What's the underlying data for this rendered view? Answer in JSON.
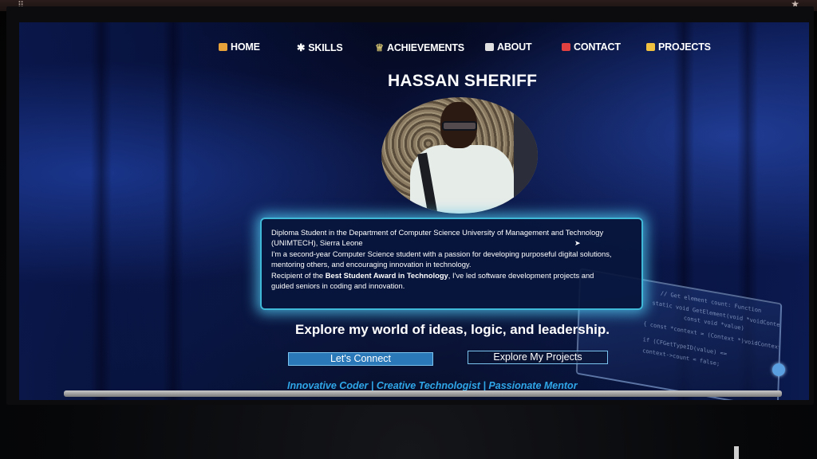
{
  "nav": {
    "items": [
      {
        "label": "HOME",
        "icon": "home-icon",
        "color": "#e8a23a"
      },
      {
        "label": "SKILLS",
        "icon": "gear-icon",
        "color": "#e0e0e0"
      },
      {
        "label": "ACHIEVEMENTS",
        "icon": "trophy-icon",
        "color": "#d0c070"
      },
      {
        "label": "ABOUT",
        "icon": "id-card-icon",
        "color": "#e0e0e0"
      },
      {
        "label": "CONTACT",
        "icon": "mailbox-icon",
        "color": "#e04040"
      },
      {
        "label": "PROJECTS",
        "icon": "folder-icon",
        "color": "#f0c040"
      }
    ]
  },
  "hero": {
    "name": "HASSAN SHERIFF"
  },
  "bio": {
    "line1": "Diploma Student in the Department of Computer Science University of Management and Technology",
    "line2": "(UNIMTECH), Sierra Leone",
    "line3": "I'm a second-year Computer Science student with a passion for developing purposeful digital solutions,",
    "line4": "mentoring others, and encouraging innovation in technology.",
    "line5_prefix": "Recipient of the ",
    "line5_bold": "Best Student Award in Technology",
    "line5_suffix": ", I've led software development projects and",
    "line6": "guided seniors in coding and innovation."
  },
  "tagline": "Explore my world of ideas, logic, and leadership.",
  "buttons": {
    "connect": "Let's Connect",
    "projects": "Explore My Projects"
  },
  "roles": "Innovative Coder | Creative Technologist | Passionate Mentor",
  "colors": {
    "accent_glow": "#3fb8d8",
    "button_blue": "#2a78b8",
    "roles_blue": "#2fa6e8"
  }
}
